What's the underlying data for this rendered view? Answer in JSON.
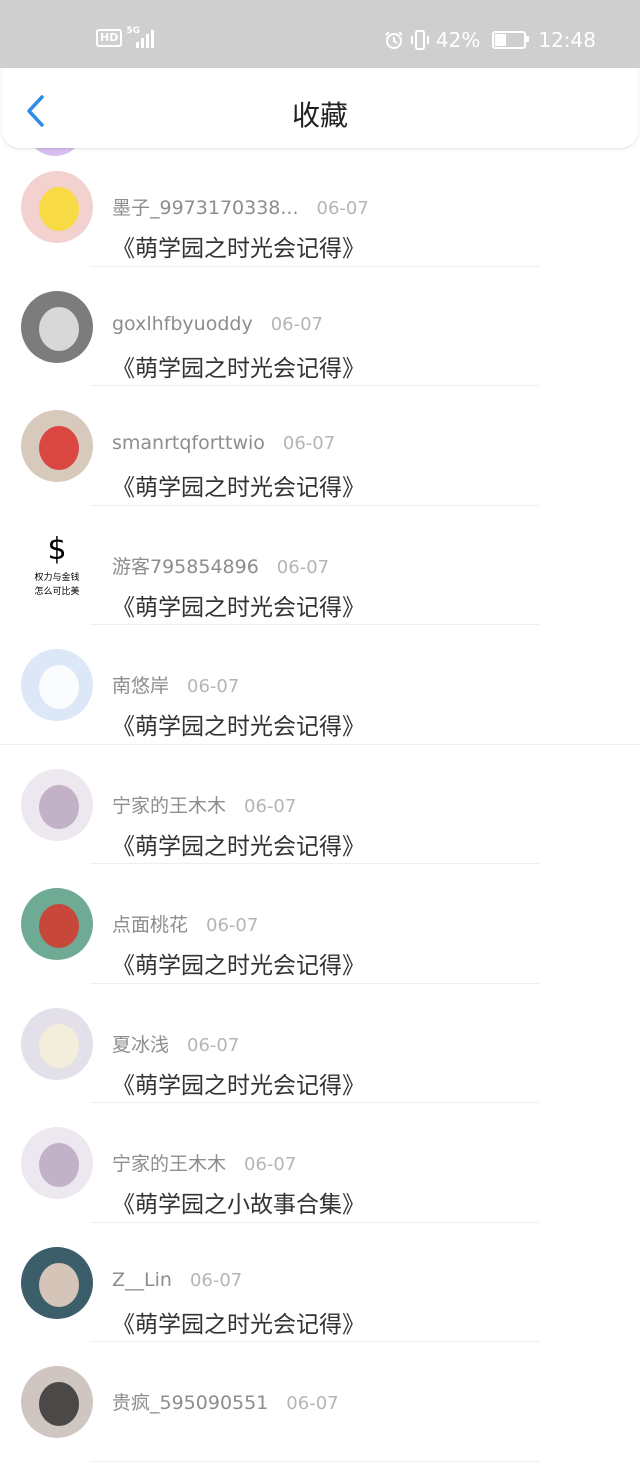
{
  "status_bar": {
    "hd": "HD",
    "network": "5G",
    "battery": "42%",
    "battery_level": 0.42,
    "time": "12:48"
  },
  "header": {
    "title": "收藏",
    "back_icon": "chevron-left-icon",
    "accent_color": "#2f8de4"
  },
  "items": [
    {
      "username": "墨子_9973170338...",
      "date": "06-07",
      "work": "《萌学园之时光会记得》",
      "avatar": {
        "bg": "#f3d1ce",
        "accent": "#f7dc2c",
        "kind": "pikachu"
      }
    },
    {
      "username": "goxlhfbyuoddy",
      "date": "06-07",
      "work": "《萌学园之时光会记得》",
      "avatar": {
        "bg": "#7c7c7c",
        "accent": "#e9e9e9",
        "kind": "bw-photo"
      }
    },
    {
      "username": "smanrtqforttwio",
      "date": "06-07",
      "work": "《萌学园之时光会记得》",
      "avatar": {
        "bg": "#d8c9bd",
        "accent": "#d9302a",
        "kind": "photo"
      }
    },
    {
      "username": "游客795854896",
      "date": "06-07",
      "work": "《萌学园之时光会记得》",
      "avatar": {
        "bg": "#ffffff",
        "accent": "#000000",
        "kind": "text",
        "symbol": "$",
        "line1": "权力与金钱",
        "line2": "怎么可比美"
      }
    },
    {
      "username": "南悠岸",
      "date": "06-07",
      "work": "《萌学园之时光会记得》",
      "avatar": {
        "bg": "#dce8f7",
        "accent": "#ffffff",
        "kind": "bear"
      }
    },
    {
      "username": "宁家的王木木",
      "date": "06-07",
      "work": "《萌学园之时光会记得》",
      "avatar": {
        "bg": "#ede8ef",
        "accent": "#b9a8c0",
        "kind": "anime"
      }
    },
    {
      "username": "点面桃花",
      "date": "06-07",
      "work": "《萌学园之时光会记得》",
      "avatar": {
        "bg": "#6fab94",
        "accent": "#d8352b",
        "kind": "painting"
      }
    },
    {
      "username": "夏冰浅",
      "date": "06-07",
      "work": "《萌学园之时光会记得》",
      "avatar": {
        "bg": "#e4e0e9",
        "accent": "#f4f0d8",
        "kind": "flower"
      }
    },
    {
      "username": "宁家的王木木",
      "date": "06-07",
      "work": "《萌学园之小故事合集》",
      "avatar": {
        "bg": "#ede8ef",
        "accent": "#b9a8c0",
        "kind": "anime"
      }
    },
    {
      "username": "Z__Lin",
      "date": "06-07",
      "work": "《萌学园之时光会记得》",
      "avatar": {
        "bg": "#3c5e6a",
        "accent": "#f0d6c6",
        "kind": "portrait"
      }
    },
    {
      "username": "贵疯_595090551",
      "date": "06-07",
      "work": "",
      "avatar": {
        "bg": "#cfc6c1",
        "accent": "#333333",
        "kind": "portrait"
      }
    }
  ]
}
